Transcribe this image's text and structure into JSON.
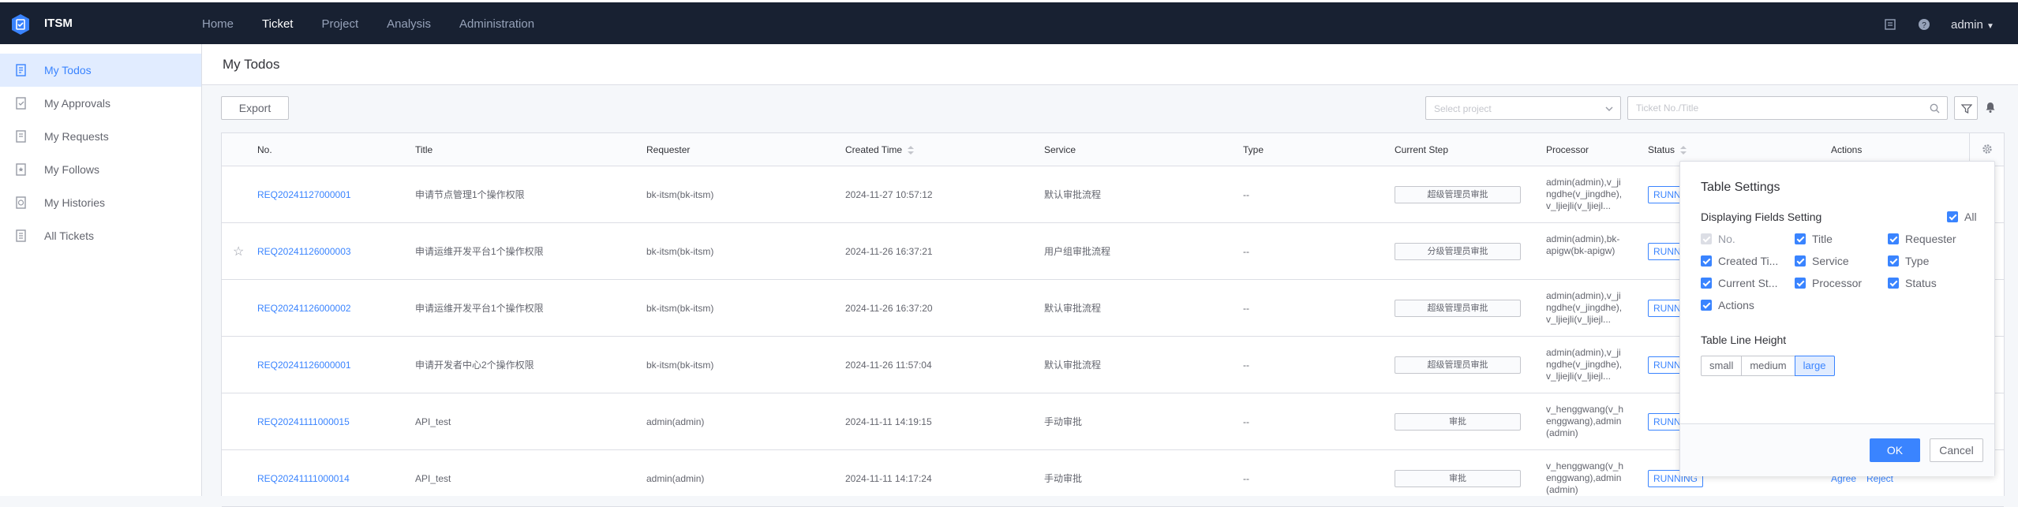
{
  "app": {
    "title": "ITSM"
  },
  "nav": [
    "Home",
    "Ticket",
    "Project",
    "Analysis",
    "Administration"
  ],
  "user": {
    "name": "admin"
  },
  "sidebar": [
    {
      "label": "My Todos",
      "icon": "todo-list-icon"
    },
    {
      "label": "My Approvals",
      "icon": "approval-icon"
    },
    {
      "label": "My Requests",
      "icon": "request-icon"
    },
    {
      "label": "My Follows",
      "icon": "follow-icon"
    },
    {
      "label": "My Histories",
      "icon": "history-icon"
    },
    {
      "label": "All Tickets",
      "icon": "ticket-icon"
    }
  ],
  "page": {
    "title": "My Todos"
  },
  "toolbar": {
    "export_label": "Export",
    "project_placeholder": "Select project",
    "search_placeholder": "Ticket No./Title"
  },
  "table": {
    "headers": {
      "no": "No.",
      "title": "Title",
      "requester": "Requester",
      "created": "Created Time",
      "service": "Service",
      "type": "Type",
      "step": "Current Step",
      "processor": "Processor",
      "status": "Status",
      "actions": "Actions"
    },
    "rows": [
      {
        "no": "REQ20241127000001",
        "title": "申请节点管理1个操作权限",
        "requester": "bk-itsm(bk-itsm)",
        "created": "2024-11-27 10:57:12",
        "service": "默认审批流程",
        "type": "--",
        "step": "超级管理员审批",
        "processor": "admin(admin),v_jingdhe(v_jingdhe),v_ljiejli(v_ljiejl...",
        "status": "RUNNING"
      },
      {
        "no": "REQ20241126000003",
        "title": "申请运维开发平台1个操作权限",
        "requester": "bk-itsm(bk-itsm)",
        "created": "2024-11-26 16:37:21",
        "service": "用户组审批流程",
        "type": "--",
        "step": "分级管理员审批",
        "processor": "admin(admin),bk-apigw(bk-apigw)",
        "status": "RUNNING"
      },
      {
        "no": "REQ20241126000002",
        "title": "申请运维开发平台1个操作权限",
        "requester": "bk-itsm(bk-itsm)",
        "created": "2024-11-26 16:37:20",
        "service": "默认审批流程",
        "type": "--",
        "step": "超级管理员审批",
        "processor": "admin(admin),v_jingdhe(v_jingdhe),v_ljiejli(v_ljiejl...",
        "status": "RUNNING"
      },
      {
        "no": "REQ20241126000001",
        "title": "申请开发者中心2个操作权限",
        "requester": "bk-itsm(bk-itsm)",
        "created": "2024-11-26 11:57:04",
        "service": "默认审批流程",
        "type": "--",
        "step": "超级管理员审批",
        "processor": "admin(admin),v_jingdhe(v_jingdhe),v_ljiejli(v_ljiejl...",
        "status": "RUNNING"
      },
      {
        "no": "REQ20241111000015",
        "title": "API_test",
        "requester": "admin(admin)",
        "created": "2024-11-11 14:19:15",
        "service": "手动审批",
        "type": "--",
        "step": "审批",
        "processor": "v_henggwang(v_henggwang),admin(admin)",
        "status": "RUNNING"
      },
      {
        "no": "REQ20241111000014",
        "title": "API_test",
        "requester": "admin(admin)",
        "created": "2024-11-11 14:17:24",
        "service": "手动审批",
        "type": "--",
        "step": "审批",
        "processor": "v_henggwang(v_henggwang),admin(admin)",
        "status": "RUNNING",
        "actions": [
          "Agree",
          "Reject"
        ]
      }
    ]
  },
  "settings": {
    "title": "Table Settings",
    "fields_label": "Displaying Fields Setting",
    "all_label": "All",
    "fields": [
      "No.",
      "Title",
      "Requester",
      "Created Ti...",
      "Service",
      "Type",
      "Current St...",
      "Processor",
      "Status",
      "Actions"
    ],
    "line_height_label": "Table Line Height",
    "sizes": [
      "small",
      "medium",
      "large"
    ],
    "selected_size": "large",
    "ok_label": "OK",
    "cancel_label": "Cancel"
  }
}
